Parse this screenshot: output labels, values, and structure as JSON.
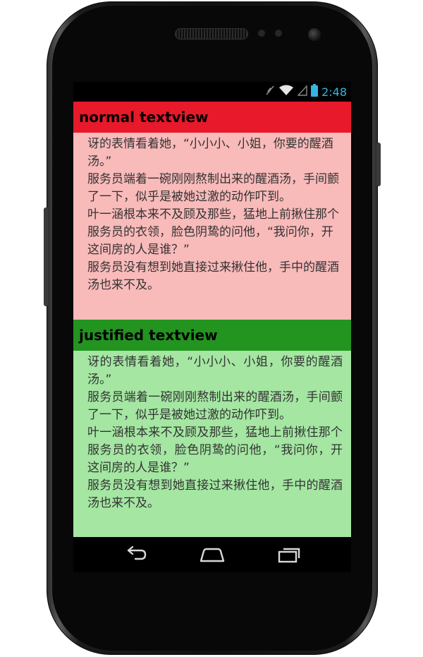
{
  "status_bar": {
    "time": "2:48"
  },
  "sections": [
    {
      "title": "normal textview",
      "paragraphs": [
        "讶的表情看着她，“小小小、小姐，你要的醒酒汤。”",
        "服务员端着一碗刚刚熬制出来的醒酒汤，手间颤了一下，似乎是被她过激的动作吓到。",
        "叶一涵根本来不及顾及那些，猛地上前揪住那个服务员的衣领，脸色阴鸷的问他，“我问你，开这间房的人是谁？”",
        "服务员没有想到她直接过来揪住他，手中的醒酒汤也来不及。"
      ]
    },
    {
      "title": "justified textview",
      "paragraphs": [
        "讶的表情看着她，“小小小、小姐，你要的醒酒汤。”",
        "服务员端着一碗刚刚熬制出来的醒酒汤，手间颤了一下，似乎是被她过激的动作吓到。",
        "叶一涵根本来不及顾及那些，猛地上前揪住那个服务员的衣领，脸色阴鸷的问他，“我问你，开这间房的人是谁？”",
        "服务员没有想到她直接过来揪住他，手中的醒酒汤也来不及。"
      ]
    }
  ],
  "colors": {
    "normal_header": "#e8192a",
    "normal_body": "#f9baba",
    "justified_header": "#22941f",
    "justified_body": "#a4e6a2",
    "status_accent": "#33b5e5"
  },
  "icons": {
    "status": [
      "mute-icon",
      "wifi-icon",
      "signal-icon",
      "battery-icon"
    ],
    "nav": [
      "back-icon",
      "home-icon",
      "recent-apps-icon"
    ]
  }
}
